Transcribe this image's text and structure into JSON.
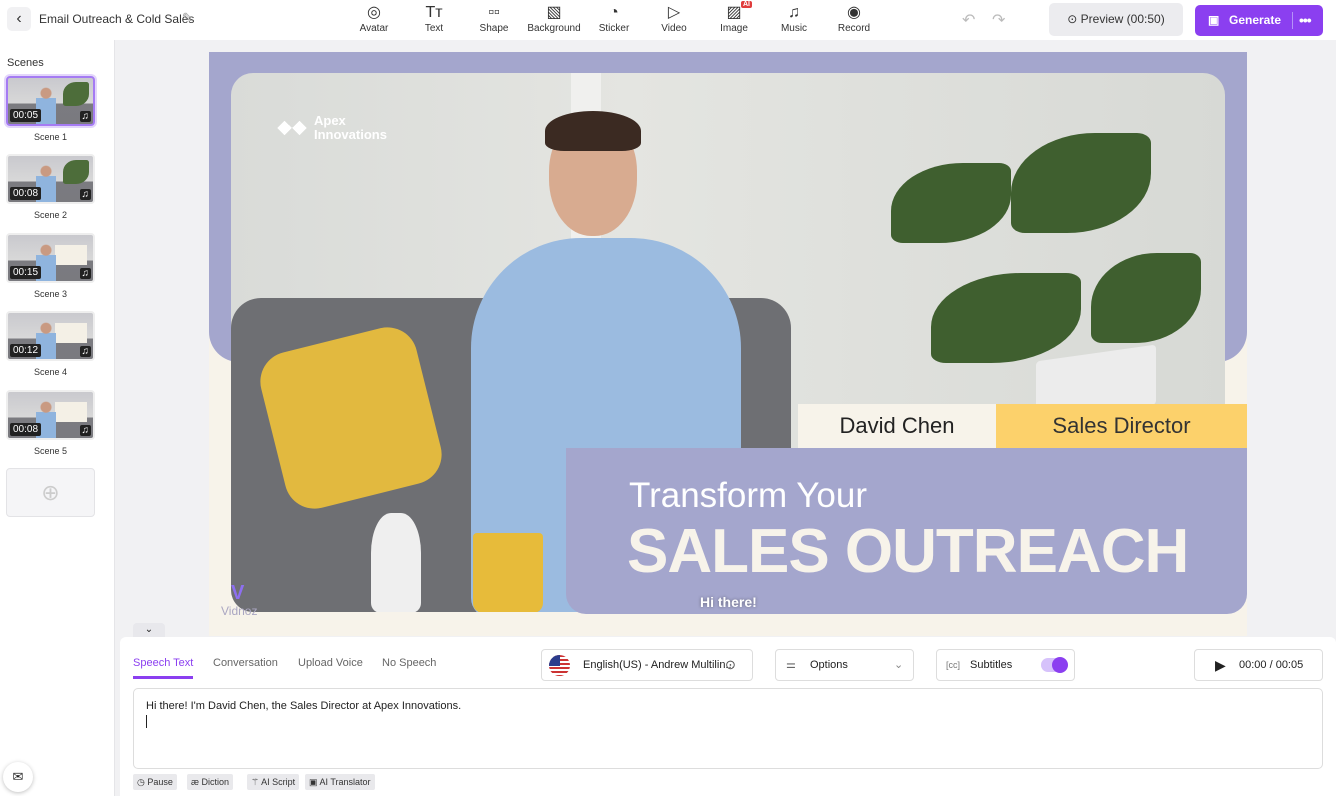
{
  "header": {
    "title": "Email Outreach & Cold Sales",
    "preview_label": "Preview (00:50)",
    "generate_label": "Generate",
    "tools": [
      {
        "label": "Avatar",
        "icon": "avatar-icon"
      },
      {
        "label": "Text",
        "icon": "text-icon"
      },
      {
        "label": "Shape",
        "icon": "shape-icon"
      },
      {
        "label": "Background",
        "icon": "background-icon"
      },
      {
        "label": "Sticker",
        "icon": "sticker-icon"
      },
      {
        "label": "Video",
        "icon": "video-icon"
      },
      {
        "label": "Image",
        "icon": "image-icon",
        "badge": "AI"
      },
      {
        "label": "Music",
        "icon": "music-icon"
      },
      {
        "label": "Record",
        "icon": "record-icon"
      }
    ]
  },
  "sidebar": {
    "heading": "Scenes",
    "scenes": [
      {
        "label": "Scene 1",
        "duration": "00:05"
      },
      {
        "label": "Scene 2",
        "duration": "00:08"
      },
      {
        "label": "Scene 3",
        "duration": "00:15"
      },
      {
        "label": "Scene 4",
        "duration": "00:12"
      },
      {
        "label": "Scene 5",
        "duration": "00:08"
      }
    ]
  },
  "canvas": {
    "logo_line1": "Apex",
    "logo_line2": "Innovations",
    "name": "David Chen",
    "role": "Sales Director",
    "headline1": "Transform Your",
    "headline2": "SALES OUTREACH",
    "subtitle": "Hi there!",
    "watermark": "Vidnoz"
  },
  "speech": {
    "tabs": [
      "Speech Text",
      "Conversation",
      "Upload Voice",
      "No Speech"
    ],
    "voice": "English(US) - Andrew Multilin...",
    "options_label": "Options",
    "subtitles_label": "Subtitles",
    "subtitles_on": true,
    "time": "00:00 / 00:05",
    "text": "Hi there! I'm David Chen, the Sales Director at Apex Innovations.",
    "chips": [
      "Pause",
      "Diction",
      "AI Script",
      "AI Translator"
    ]
  },
  "colors": {
    "accent": "#8b3ff0",
    "lavender": "#a4a6cd",
    "yellow": "#fcd16b"
  }
}
